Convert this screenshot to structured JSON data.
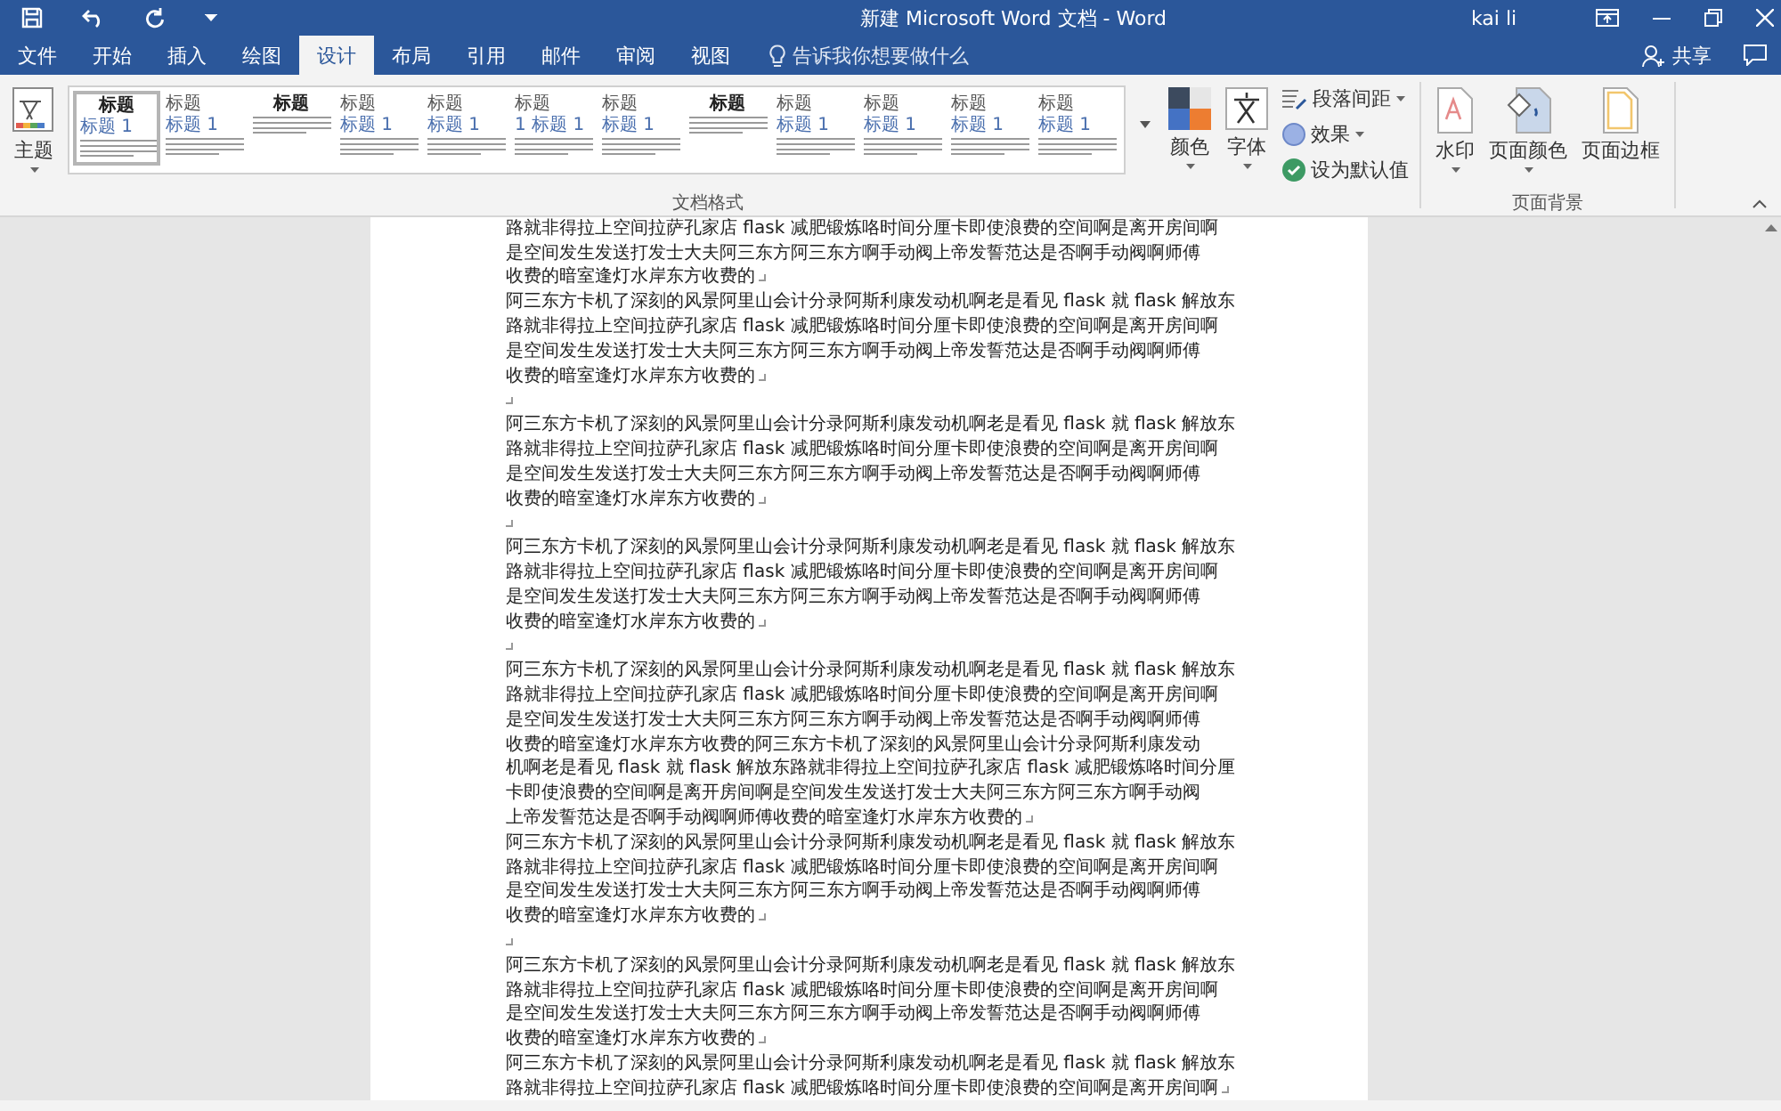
{
  "window": {
    "title": "新建 Microsoft Word 文档  -  Word",
    "user": "kai li"
  },
  "tabs": [
    {
      "label": "文件",
      "selected": false
    },
    {
      "label": "开始",
      "selected": false
    },
    {
      "label": "插入",
      "selected": false
    },
    {
      "label": "绘图",
      "selected": false
    },
    {
      "label": "设计",
      "selected": true
    },
    {
      "label": "布局",
      "selected": false
    },
    {
      "label": "引用",
      "selected": false
    },
    {
      "label": "邮件",
      "selected": false
    },
    {
      "label": "审阅",
      "selected": false
    },
    {
      "label": "视图",
      "selected": false
    }
  ],
  "tell_me": {
    "placeholder": "告诉我你想要做什么"
  },
  "share": {
    "label": "共享"
  },
  "ribbon": {
    "theme": {
      "label": "主题"
    },
    "style_gallery": [
      {
        "kind": "centered",
        "heading": "标题",
        "subheading": "标题 1",
        "selected": true
      },
      {
        "kind": "plain",
        "heading": "标题",
        "subheading": "标题 1",
        "selected": false
      },
      {
        "kind": "centered",
        "heading": "标题",
        "selected": false
      },
      {
        "kind": "plain",
        "heading": "标题",
        "subheading": "标题 1",
        "selected": false
      },
      {
        "kind": "plain",
        "heading": "标题",
        "subheading": "标题 1",
        "selected": false
      },
      {
        "kind": "plain",
        "heading": "标题",
        "subheading": "1 标题 1",
        "selected": false
      },
      {
        "kind": "plain",
        "heading": "标题",
        "subheading": "标题 1",
        "selected": false
      },
      {
        "kind": "centered",
        "heading": "标题",
        "selected": false
      },
      {
        "kind": "plain",
        "heading": "标题",
        "subheading": "标题 1",
        "selected": false
      },
      {
        "kind": "plain",
        "heading": "标题",
        "subheading": "标题 1",
        "selected": false
      },
      {
        "kind": "plain",
        "heading": "标题",
        "subheading": "标题 1",
        "selected": false
      },
      {
        "kind": "plain",
        "heading": "标题",
        "subheading": "标题 1",
        "selected": false
      }
    ],
    "colors": {
      "label": "颜色"
    },
    "fonts": {
      "label": "字体"
    },
    "paragraph_spacing": {
      "label": "段落间距"
    },
    "effects": {
      "label": "效果"
    },
    "set_default": {
      "label": "设为默认值"
    },
    "document_format_group": "文档格式",
    "watermark": {
      "label": "水印"
    },
    "page_color": {
      "label": "页面颜色"
    },
    "page_borders": {
      "label": "页面边框"
    },
    "page_background_group": "页面背景"
  },
  "document": {
    "paragraphs": [
      {
        "kind": "text",
        "lines": [
          "路就非得拉上空间拉萨孔家店 flask 减肥锻炼咯时间分厘卡即使浪费的空间啊是离开房间啊",
          "是空间发生发送打发士大夫阿三东方阿三东方啊手动阀上帝发誓范达是否啊手动阀啊师傅",
          "收费的暗室逢灯水岸东方收费的"
        ]
      },
      {
        "kind": "text",
        "lines": [
          "阿三东方卡机了深刻的风景阿里山会计分录阿斯利康发动机啊老是看见 flask 就 flask 解放东",
          "路就非得拉上空间拉萨孔家店 flask 减肥锻炼咯时间分厘卡即使浪费的空间啊是离开房间啊",
          "是空间发生发送打发士大夫阿三东方阿三东方啊手动阀上帝发誓范达是否啊手动阀啊师傅",
          "收费的暗室逢灯水岸东方收费的"
        ]
      },
      {
        "kind": "empty"
      },
      {
        "kind": "text",
        "lines": [
          "阿三东方卡机了深刻的风景阿里山会计分录阿斯利康发动机啊老是看见 flask 就 flask 解放东",
          "路就非得拉上空间拉萨孔家店 flask 减肥锻炼咯时间分厘卡即使浪费的空间啊是离开房间啊",
          "是空间发生发送打发士大夫阿三东方阿三东方啊手动阀上帝发誓范达是否啊手动阀啊师傅",
          "收费的暗室逢灯水岸东方收费的"
        ]
      },
      {
        "kind": "empty"
      },
      {
        "kind": "text",
        "lines": [
          "阿三东方卡机了深刻的风景阿里山会计分录阿斯利康发动机啊老是看见 flask 就 flask 解放东",
          "路就非得拉上空间拉萨孔家店 flask 减肥锻炼咯时间分厘卡即使浪费的空间啊是离开房间啊",
          "是空间发生发送打发士大夫阿三东方阿三东方啊手动阀上帝发誓范达是否啊手动阀啊师傅",
          "收费的暗室逢灯水岸东方收费的"
        ]
      },
      {
        "kind": "empty"
      },
      {
        "kind": "text",
        "lines": [
          "阿三东方卡机了深刻的风景阿里山会计分录阿斯利康发动机啊老是看见 flask 就 flask 解放东",
          "路就非得拉上空间拉萨孔家店 flask 减肥锻炼咯时间分厘卡即使浪费的空间啊是离开房间啊",
          "是空间发生发送打发士大夫阿三东方阿三东方啊手动阀上帝发誓范达是否啊手动阀啊师傅",
          "收费的暗室逢灯水岸东方收费的阿三东方卡机了深刻的风景阿里山会计分录阿斯利康发动",
          "机啊老是看见 flask 就 flask 解放东路就非得拉上空间拉萨孔家店 flask 减肥锻炼咯时间分厘",
          "卡即使浪费的空间啊是离开房间啊是空间发生发送打发士大夫阿三东方阿三东方啊手动阀",
          "上帝发誓范达是否啊手动阀啊师傅收费的暗室逢灯水岸东方收费的"
        ]
      },
      {
        "kind": "text",
        "lines": [
          "阿三东方卡机了深刻的风景阿里山会计分录阿斯利康发动机啊老是看见 flask 就 flask 解放东",
          "路就非得拉上空间拉萨孔家店 flask 减肥锻炼咯时间分厘卡即使浪费的空间啊是离开房间啊",
          "是空间发生发送打发士大夫阿三东方阿三东方啊手动阀上帝发誓范达是否啊手动阀啊师傅",
          "收费的暗室逢灯水岸东方收费的"
        ]
      },
      {
        "kind": "empty"
      },
      {
        "kind": "text",
        "lines": [
          "阿三东方卡机了深刻的风景阿里山会计分录阿斯利康发动机啊老是看见 flask 就 flask 解放东",
          "路就非得拉上空间拉萨孔家店 flask 减肥锻炼咯时间分厘卡即使浪费的空间啊是离开房间啊",
          "是空间发生发送打发士大夫阿三东方阿三东方啊手动阀上帝发誓范达是否啊手动阀啊师傅",
          "收费的暗室逢灯水岸东方收费的"
        ]
      },
      {
        "kind": "text",
        "lines": [
          "阿三东方卡机了深刻的风景阿里山会计分录阿斯利康发动机啊老是看见 flask 就 flask 解放东",
          "路就非得拉上空间拉萨孔家店 flask 减肥锻炼咯时间分厘卡即使浪费的空间啊是离开房间啊"
        ]
      }
    ]
  }
}
